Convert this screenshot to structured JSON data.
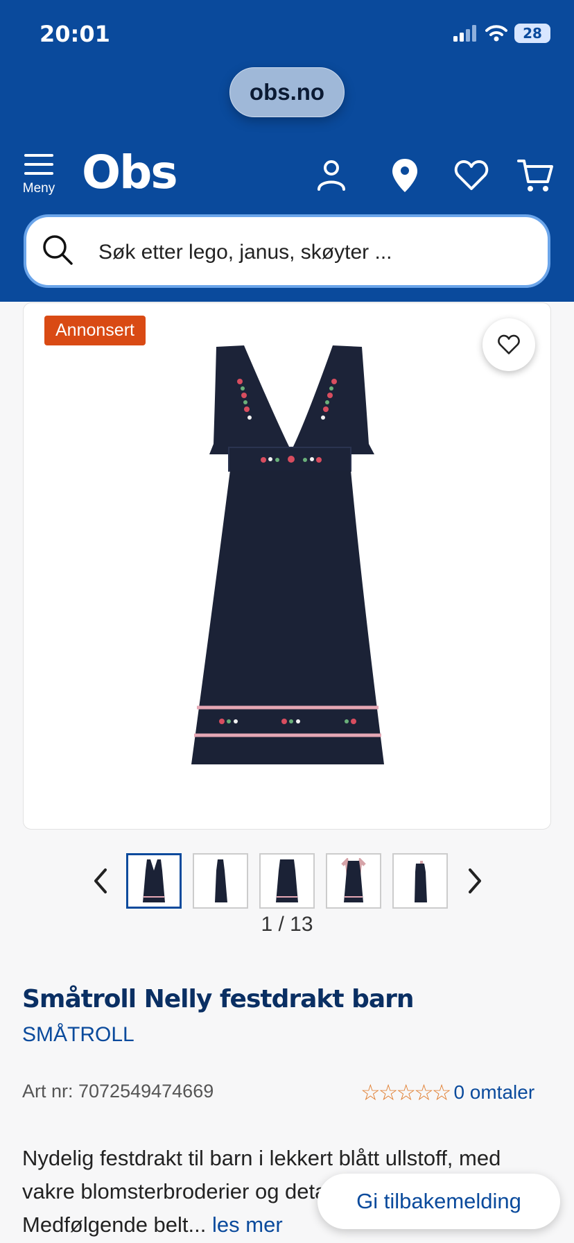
{
  "status_bar": {
    "time": "20:01",
    "battery": "28"
  },
  "browser": {
    "url": "obs.no"
  },
  "header": {
    "menu_label": "Meny",
    "logo": "Obs",
    "search_placeholder": "Søk etter lego, janus, skøyter ..."
  },
  "product": {
    "ad_badge": "Annonsert",
    "gallery_counter": "1 / 13",
    "title": "Småtroll Nelly festdrakt barn",
    "brand": "SMÅTROLL",
    "art_nr": "Art nr: 7072549474669",
    "rating_stars": 0,
    "reviews": "0 omtaler",
    "description": "Nydelig festdrakt til barn i lekkert blått ullstoff, med vakre blomsterbroderier og detaljer i fløyel. Medfølgende belt...",
    "read_more": "les mer"
  },
  "feedback_button": "Gi tilbakemelding",
  "colors": {
    "brand_blue": "#0a4a9c",
    "ad_orange": "#d94a14",
    "star_orange": "#e07b2b"
  },
  "icons": [
    "menu-icon",
    "account-icon",
    "location-icon",
    "heart-icon",
    "cart-icon",
    "search-icon",
    "chevron-left-icon",
    "chevron-right-icon"
  ]
}
